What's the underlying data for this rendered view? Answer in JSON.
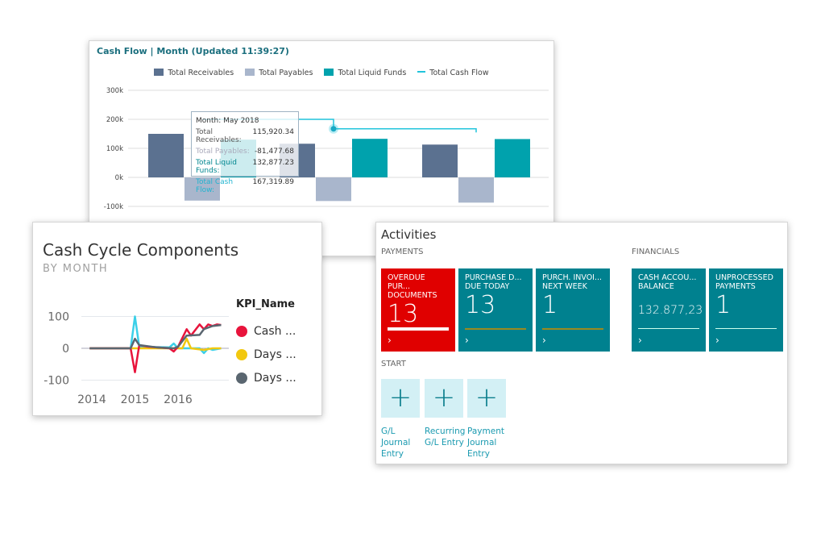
{
  "cash_flow": {
    "title": "Cash Flow | Month (Updated 11:39:27)",
    "tooltip": {
      "month": "Month: May 2018",
      "rows": [
        {
          "label": "Total Receivables:",
          "value": "115,920.34"
        },
        {
          "label": "Total Payables:",
          "value": "-81,477.68"
        },
        {
          "label": "Total Liquid Funds:",
          "value": "132,877.23"
        },
        {
          "label": "Total Cash Flow:",
          "value": "167,319.89"
        }
      ]
    }
  },
  "cash_cycle": {
    "title": "Cash Cycle Components",
    "subtitle": "BY MONTH",
    "legend_title": "KPI_Name",
    "legend": [
      "Cash ...",
      "Days ...",
      "Days ..."
    ]
  },
  "activities": {
    "title": "Activities",
    "payments_label": "PAYMENTS",
    "financials_label": "FINANCIALS",
    "start_label": "START",
    "tiles": [
      {
        "title1": "OVERDUE PUR...",
        "title2": "DOCUMENTS",
        "value": "13",
        "color": "#e00000"
      },
      {
        "title1": "PURCHASE D...",
        "title2": "DUE TODAY",
        "value": "13",
        "color": "#00818f"
      },
      {
        "title1": "PURCH. INVOI...",
        "title2": "NEXT WEEK",
        "value": "1",
        "color": "#00818f"
      },
      {
        "title1": "CASH ACCOU...",
        "title2": "BALANCE",
        "value": "132.877,23",
        "color": "#00818f"
      },
      {
        "title1": "UNPROCESSED",
        "title2": "PAYMENTS",
        "value": "1",
        "color": "#00818f"
      }
    ],
    "chevron": "›",
    "start_tiles": [
      {
        "icon": "plus-icon",
        "glyph": "+",
        "l1": "G/L",
        "l2": "Journal",
        "l3": "Entry"
      },
      {
        "icon": "plus-icon",
        "glyph": "+",
        "l1": "Recurring",
        "l2": "G/L Entry",
        "l3": ""
      },
      {
        "icon": "plus-icon",
        "glyph": "+",
        "l1": "Payment",
        "l2": "Journal",
        "l3": "Entry"
      }
    ]
  },
  "chart_data": [
    {
      "type": "bar",
      "title": "Cash Flow | Month (Updated 11:39:27)",
      "ylim": [
        -100000,
        300000
      ],
      "yticks": [
        "300k",
        "200k",
        "100k",
        "0k",
        "-100k"
      ],
      "ytick_values": [
        300000,
        200000,
        100000,
        0,
        -100000
      ],
      "grid": true,
      "legend_position": "top",
      "series": [
        {
          "name": "Total Receivables",
          "kind": "bar",
          "color": "#5b7190",
          "values": [
            150000,
            115920.34,
            113000
          ]
        },
        {
          "name": "Total Payables",
          "kind": "bar",
          "color": "#a9b6cc",
          "values": [
            -80000,
            -81477.68,
            -87000
          ]
        },
        {
          "name": "Total Liquid Funds",
          "kind": "bar",
          "color": "#00a2ad",
          "values": [
            130000,
            132877.23,
            132000
          ]
        },
        {
          "name": "Total Cash Flow",
          "kind": "line",
          "color": "#21c4dc",
          "values": [
            200000,
            167319.89,
            155000
          ]
        }
      ]
    },
    {
      "type": "line",
      "title": "Cash Cycle Components",
      "subtitle": "BY MONTH",
      "ylim": [
        -100,
        100
      ],
      "yticks": [
        "100",
        "0",
        "-100"
      ],
      "ytick_values": [
        100,
        0,
        -100
      ],
      "xticks": [
        "2014",
        "2015",
        "2016"
      ],
      "xtick_values": [
        2014,
        2015,
        2016
      ],
      "legend_title": "KPI_Name",
      "legend_position": "right",
      "series": [
        {
          "name": "Cash ...",
          "color": "#e8143c",
          "points": [
            [
              2013.95,
              0
            ],
            [
              2014.9,
              0
            ],
            [
              2015.0,
              -75
            ],
            [
              2015.1,
              10
            ],
            [
              2015.3,
              5
            ],
            [
              2015.8,
              0
            ],
            [
              2015.9,
              -10
            ],
            [
              2016.0,
              5
            ],
            [
              2016.2,
              60
            ],
            [
              2016.3,
              40
            ],
            [
              2016.5,
              75
            ],
            [
              2016.6,
              60
            ],
            [
              2016.7,
              75
            ],
            [
              2016.8,
              70
            ],
            [
              2016.9,
              75
            ],
            [
              2017.0,
              73
            ]
          ]
        },
        {
          "name": "Days ...",
          "color": "#f2c80f",
          "points": [
            [
              2013.95,
              0
            ],
            [
              2016.1,
              0
            ],
            [
              2016.2,
              30
            ],
            [
              2016.3,
              0
            ],
            [
              2016.6,
              -5
            ],
            [
              2016.8,
              0
            ],
            [
              2017.0,
              0
            ]
          ]
        },
        {
          "name": "Days ...",
          "color": "#5a6670",
          "points": [
            [
              2013.95,
              0
            ],
            [
              2014.9,
              0
            ],
            [
              2015.0,
              30
            ],
            [
              2015.1,
              10
            ],
            [
              2015.5,
              3
            ],
            [
              2015.9,
              0
            ],
            [
              2016.0,
              5
            ],
            [
              2016.2,
              40
            ],
            [
              2016.5,
              42
            ],
            [
              2016.6,
              60
            ],
            [
              2016.8,
              70
            ],
            [
              2017.0,
              73
            ]
          ]
        },
        {
          "color": "#3cd0e8",
          "points": [
            [
              2013.95,
              0
            ],
            [
              2014.9,
              0
            ],
            [
              2015.0,
              100
            ],
            [
              2015.1,
              5
            ],
            [
              2015.8,
              3
            ],
            [
              2015.9,
              15
            ],
            [
              2016.0,
              0
            ],
            [
              2016.5,
              0
            ],
            [
              2016.6,
              -15
            ],
            [
              2016.7,
              0
            ],
            [
              2016.8,
              -5
            ],
            [
              2017.0,
              0
            ]
          ]
        }
      ]
    }
  ]
}
